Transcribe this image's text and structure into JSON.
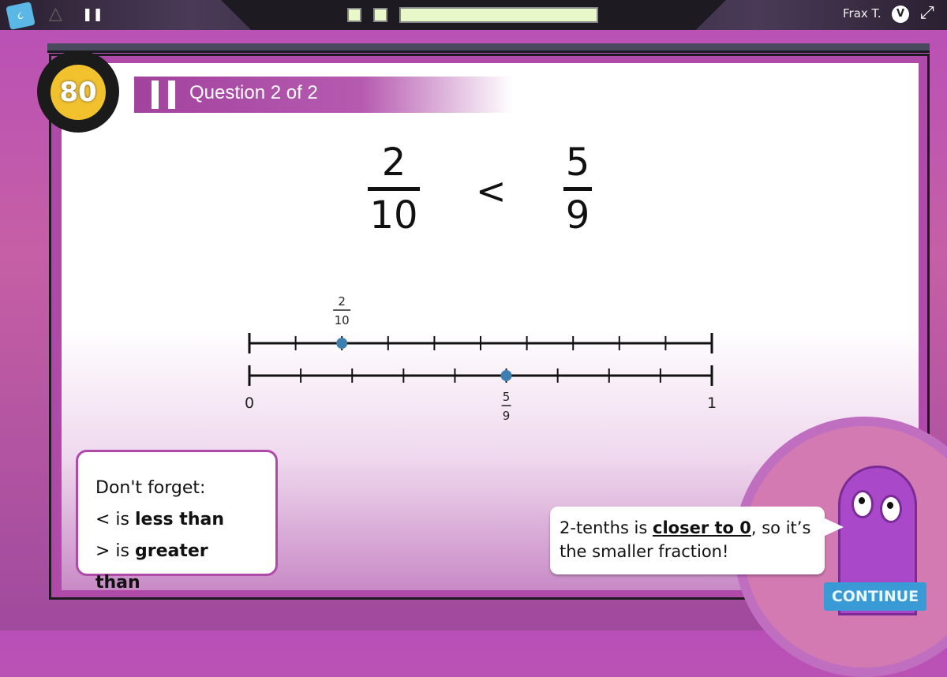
{
  "topbar": {
    "user_name": "Frax T.",
    "user_badge": "V",
    "logo_text": "૮",
    "progress_fraction": 1.0
  },
  "header": {
    "score": "80",
    "question_label": "Question 2 of 2"
  },
  "comparison": {
    "left": {
      "numerator": "2",
      "denominator": "10"
    },
    "operator": "<",
    "right": {
      "numerator": "5",
      "denominator": "9"
    }
  },
  "number_lines": {
    "top": {
      "divisions": 10,
      "point": 0.2,
      "label_num": "2",
      "label_den": "10"
    },
    "bottom": {
      "divisions": 9,
      "point": 0.5556,
      "label_num": "5",
      "label_den": "9"
    },
    "start_label": "0",
    "end_label": "1",
    "point_color": "#3f7fb0"
  },
  "tip": {
    "title": "Don't forget:",
    "line1_prefix": "< is ",
    "line1_bold": "less than",
    "line2_prefix": "> is ",
    "line2_bold": "greater than"
  },
  "speech": {
    "part1": "2-tenths is ",
    "bold_underlined": "closer to 0",
    "part2": ", so it’s the smaller fraction!"
  },
  "continue_label": "CONTINUE",
  "colors": {
    "accent": "#b04aa8",
    "button": "#3a9ad6",
    "score": "#f2c12e"
  }
}
